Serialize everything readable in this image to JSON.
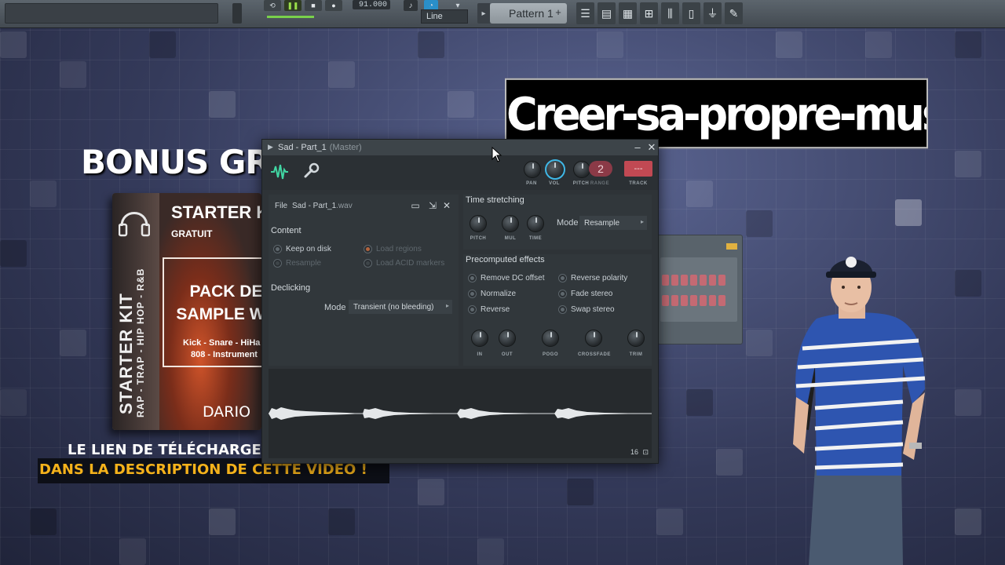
{
  "toolbar": {
    "tempo": "91.000",
    "snap_mode": "Line",
    "pattern": "Pattern 1",
    "pattern_add": "+",
    "tools": [
      "playlist-icon",
      "piano-roll-icon",
      "channel-rack-icon",
      "browser-icon",
      "mixer-icon",
      "file-icon",
      "plugin-icon",
      "help-icon"
    ]
  },
  "banner": {
    "text": "Creer-sa-propre-musique.com"
  },
  "promo": {
    "title": "BONUS GRA",
    "kit_title": "STARTER K",
    "kit_gratuit": "GRATUIT",
    "pack_line1": "PACK DE",
    "pack_line2": "SAMPLE WA",
    "list_line1": "Kick - Snare - HiHa",
    "list_line2": "808 - Instrument",
    "brand": "DARIO",
    "spine_main": "STARTER KIT",
    "spine_sub": "RAP - TRAP - HIP HOP - R&B",
    "cta_line1": "LE LIEN DE TÉLÉCHARGE",
    "cta_line2": "DANS LA DESCRIPTION DE CETTE VIDÉO !"
  },
  "plugin": {
    "title": "Sad - Part_1",
    "title_suffix": "(Master)",
    "minimize": "–",
    "close": "✕",
    "header": {
      "knobs": [
        "PAN",
        "VOL",
        "PITCH"
      ],
      "range_label": "RANGE",
      "range_value": "2",
      "track_value": "---",
      "track_label": "TRACK"
    },
    "file": {
      "label": "File",
      "name": "Sad - Part_1",
      "ext": ".wav"
    },
    "content": {
      "label": "Content",
      "keep_on_disk": "Keep on disk",
      "resample": "Resample",
      "load_regions": "Load regions",
      "load_acid": "Load ACID markers"
    },
    "declicking": {
      "label": "Declicking",
      "mode_label": "Mode",
      "mode_value": "Transient (no bleeding)"
    },
    "time_stretching": {
      "label": "Time stretching",
      "knobs": [
        "PITCH",
        "MUL",
        "TIME"
      ],
      "mode_label": "Mode",
      "mode_value": "Resample"
    },
    "precomputed": {
      "label": "Precomputed effects",
      "left": [
        "Remove DC offset",
        "Normalize",
        "Reverse"
      ],
      "right": [
        "Reverse polarity",
        "Fade stereo",
        "Swap stereo"
      ],
      "knobs": [
        "IN",
        "OUT",
        "POGO",
        "CROSSFADE",
        "TRIM"
      ]
    },
    "wave_count": "16"
  },
  "colors": {
    "accent_blue": "#3fb7e6",
    "track_red": "#c14953",
    "promo_orange": "#f5b21b",
    "wave_green": "#41d6a3"
  }
}
